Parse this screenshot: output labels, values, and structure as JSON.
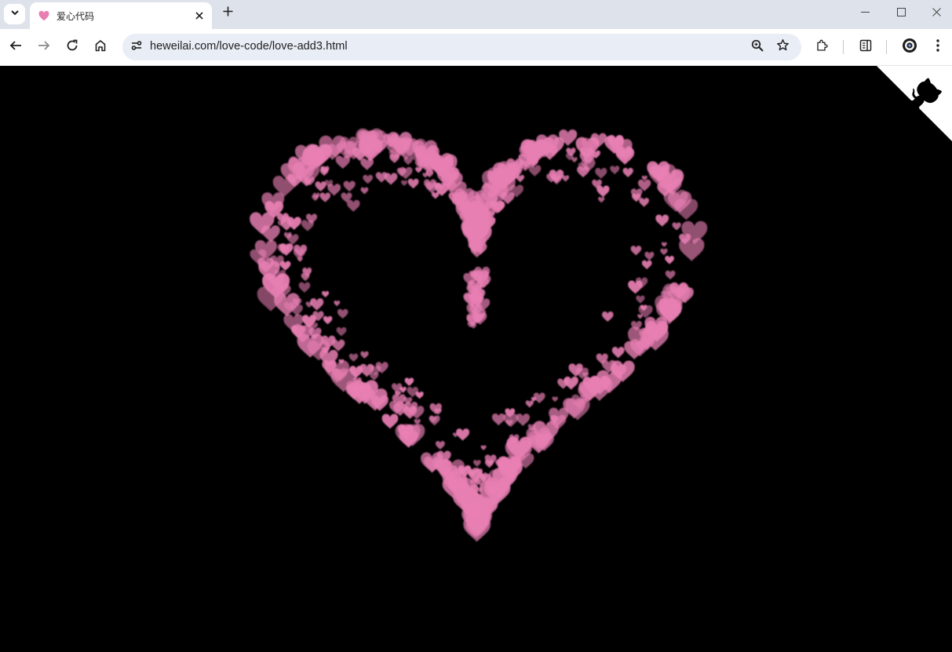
{
  "tab": {
    "title": "爱心代码",
    "favicon": "heart-icon"
  },
  "address": {
    "url": "heweilai.com/love-code/love-add3.html"
  },
  "colors": {
    "heart": "#e87fb3",
    "page_bg": "#000000",
    "chrome_bg": "#dee3eb",
    "omnibox_bg": "#e9edf6"
  },
  "icons": [
    "chevron-down-icon",
    "heart-icon",
    "close-icon",
    "plus-icon",
    "minimize-icon",
    "maximize-icon",
    "window-close-icon",
    "back-icon",
    "forward-icon",
    "reload-icon",
    "home-icon",
    "site-info-icon",
    "zoom-icon",
    "star-icon",
    "extensions-icon",
    "side-panel-icon",
    "profile-icon",
    "menu-icon",
    "github-corner-icon"
  ]
}
